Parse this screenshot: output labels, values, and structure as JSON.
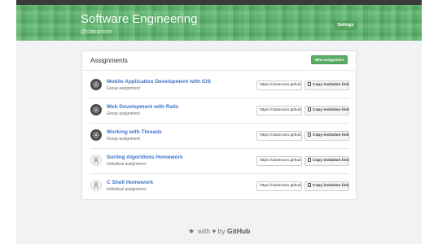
{
  "header": {
    "org_title": "Software Engineering",
    "org_handle": "@classroom",
    "settings_label": "Settings",
    "colors": {
      "banner": "#5bb36a",
      "button": "#5aad65",
      "link": "#3d74c7"
    }
  },
  "assignments": {
    "title": "Assignments",
    "new_button": "New assignment",
    "copy_label": "Copy invitation link",
    "items": [
      {
        "title": "Mobile Application Development with iOS",
        "type": "Group assignment",
        "url": "https://classroom.github.com",
        "avatar_icon": "gear-icon"
      },
      {
        "title": "Web Development with Rails",
        "type": "Group assignment",
        "url": "https://classroom.github.com",
        "avatar_icon": "gear-icon"
      },
      {
        "title": "Working with Threads",
        "type": "Group assignment",
        "url": "https://classroom.github.com",
        "avatar_icon": "gear-icon"
      },
      {
        "title": "Sorting Algorithms Homework",
        "type": "Individual assignment",
        "url": "https://classroom.github.com",
        "avatar_icon": "person-icon"
      },
      {
        "title": "C Shell Homework",
        "type": "Individual assignment",
        "url": "https://classroom.github.com",
        "avatar_icon": "person-icon"
      }
    ]
  },
  "footer": {
    "with_text": "with",
    "by_text": "by",
    "brand": "GitHub"
  }
}
